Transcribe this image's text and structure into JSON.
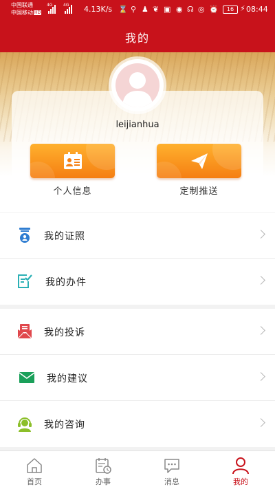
{
  "status_bar": {
    "carrier1": "中国联通",
    "carrier2": "中国移动",
    "hd_badge": "HD",
    "net1": "4G",
    "net2": "4G",
    "speed": "4.13K/s",
    "battery": "16",
    "time": "08:44",
    "icons": [
      "hourglass-icon",
      "search-icon",
      "qq-icon",
      "weibo-icon",
      "app-icon",
      "headset-icon",
      "eye-icon",
      "alarm-icon",
      "bolt-icon"
    ]
  },
  "header": {
    "title": "我的"
  },
  "profile": {
    "username": "leijianhua"
  },
  "quick_actions": [
    {
      "label": "个人信息",
      "icon": "id-card-icon"
    },
    {
      "label": "定制推送",
      "icon": "paper-plane-icon"
    }
  ],
  "menu_group_1": [
    {
      "label": "我的证照",
      "icon": "license-icon",
      "color": "#2f7dd1"
    },
    {
      "label": "我的办件",
      "icon": "task-check-icon",
      "color": "#2bb0b5"
    }
  ],
  "menu_group_2": [
    {
      "label": "我的投诉",
      "icon": "complaint-envelope-icon",
      "color": "#e0474c"
    },
    {
      "label": "我的建议",
      "icon": "mail-icon",
      "color": "#1aa05a"
    },
    {
      "label": "我的咨询",
      "icon": "consult-headset-icon",
      "color": "#8cbf2a"
    }
  ],
  "bottom_nav": [
    {
      "label": "首页",
      "icon": "home-icon",
      "active": false
    },
    {
      "label": "办事",
      "icon": "calendar-clock-icon",
      "active": false
    },
    {
      "label": "消息",
      "icon": "chat-bubble-icon",
      "active": false
    },
    {
      "label": "我的",
      "icon": "person-icon",
      "active": true
    }
  ],
  "colors": {
    "brand_red": "#c8121b",
    "button_orange": "#f57f12"
  }
}
